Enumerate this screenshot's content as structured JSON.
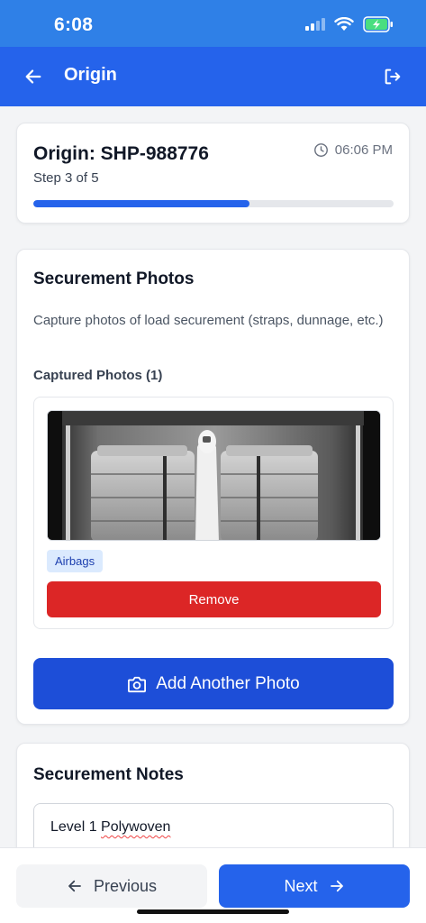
{
  "status_bar": {
    "time": "6:08"
  },
  "app_bar": {
    "title": "Origin"
  },
  "header": {
    "title": "Origin: SHP-988776",
    "step": "Step 3 of 5",
    "time": "06:06 PM",
    "progress_fraction": 0.6
  },
  "photos": {
    "title": "Securement Photos",
    "description": "Capture photos of load securement (straps, dunnage, etc.)",
    "captured_label": "Captured Photos (1)",
    "items": [
      {
        "tag": "Airbags",
        "remove_label": "Remove"
      }
    ],
    "add_label": "Add Another Photo"
  },
  "notes": {
    "title": "Securement Notes",
    "value_prefix": "Level 1 ",
    "value_misspelled": "Polywoven"
  },
  "footer": {
    "previous_label": "Previous",
    "next_label": "Next"
  },
  "colors": {
    "primary": "#2563eb",
    "status_bar": "#2f80e7",
    "danger": "#dc2626",
    "tag_bg": "#dbeafe"
  }
}
